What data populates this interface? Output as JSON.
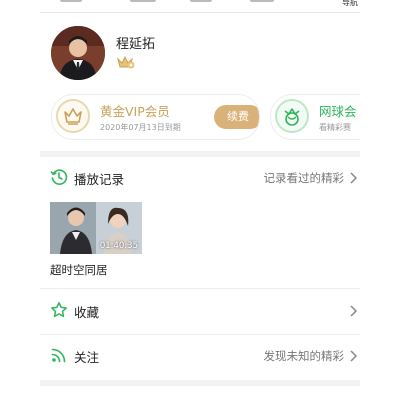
{
  "topnav": {
    "label": "导航"
  },
  "profile": {
    "username": "程延拓"
  },
  "vip_card": {
    "title": "黄金VIP会员",
    "expiry": "2020年07月13日到期",
    "renew_label": "续费"
  },
  "tennis_card": {
    "title": "网球会",
    "subtitle": "看精彩赛"
  },
  "history": {
    "label": "播放记录",
    "hint": "记录看过的精彩",
    "item": {
      "duration": "01:40:35",
      "title": "超时空同居"
    }
  },
  "favorites": {
    "label": "收藏"
  },
  "follow": {
    "label": "关注",
    "hint": "发现未知的精彩"
  },
  "colors": {
    "accent_green": "#2fb55a",
    "gold": "#d9b27a"
  }
}
